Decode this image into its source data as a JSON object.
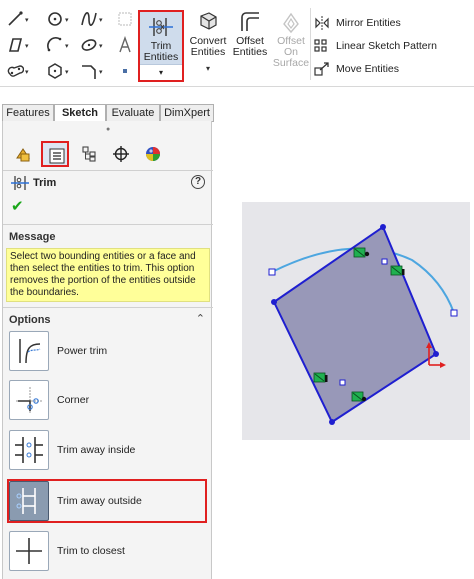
{
  "ribbon": {
    "trim": {
      "line1": "Trim",
      "line2": "Entities",
      "dropdown": "▾"
    },
    "convert": {
      "line1": "Convert",
      "line2": "Entities",
      "dropdown": "▾"
    },
    "offset": {
      "line1": "Offset",
      "line2": "Entities"
    },
    "offset_surface": {
      "line1": "Offset",
      "line2": "On",
      "line3": "Surface"
    },
    "mirror": "Mirror Entities",
    "linear_pattern": "Linear Sketch Pattern",
    "move": "Move Entities",
    "tool_dropdown": "▾"
  },
  "tabs": [
    "Features",
    "Sketch",
    "Evaluate",
    "DimXpert"
  ],
  "property_manager": {
    "title": "Trim",
    "help": "?",
    "ok": "✔",
    "message_header": "Message",
    "message_text": "Select two bounding entities or a face and then select the entities to trim. This option removes the portion of the entities outside the boundaries.",
    "options_header": "Options",
    "collapse": "⌃",
    "options": [
      {
        "label": "Power trim"
      },
      {
        "label": "Corner"
      },
      {
        "label": "Trim away inside"
      },
      {
        "label": "Trim away outside"
      },
      {
        "label": "Trim to closest"
      }
    ]
  },
  "colors": {
    "highlight": "#e02020",
    "sketch_line": "#1f1fd0",
    "face_fill": "#9898b8",
    "arc": "#4da6e0",
    "relation": "#20b050"
  }
}
